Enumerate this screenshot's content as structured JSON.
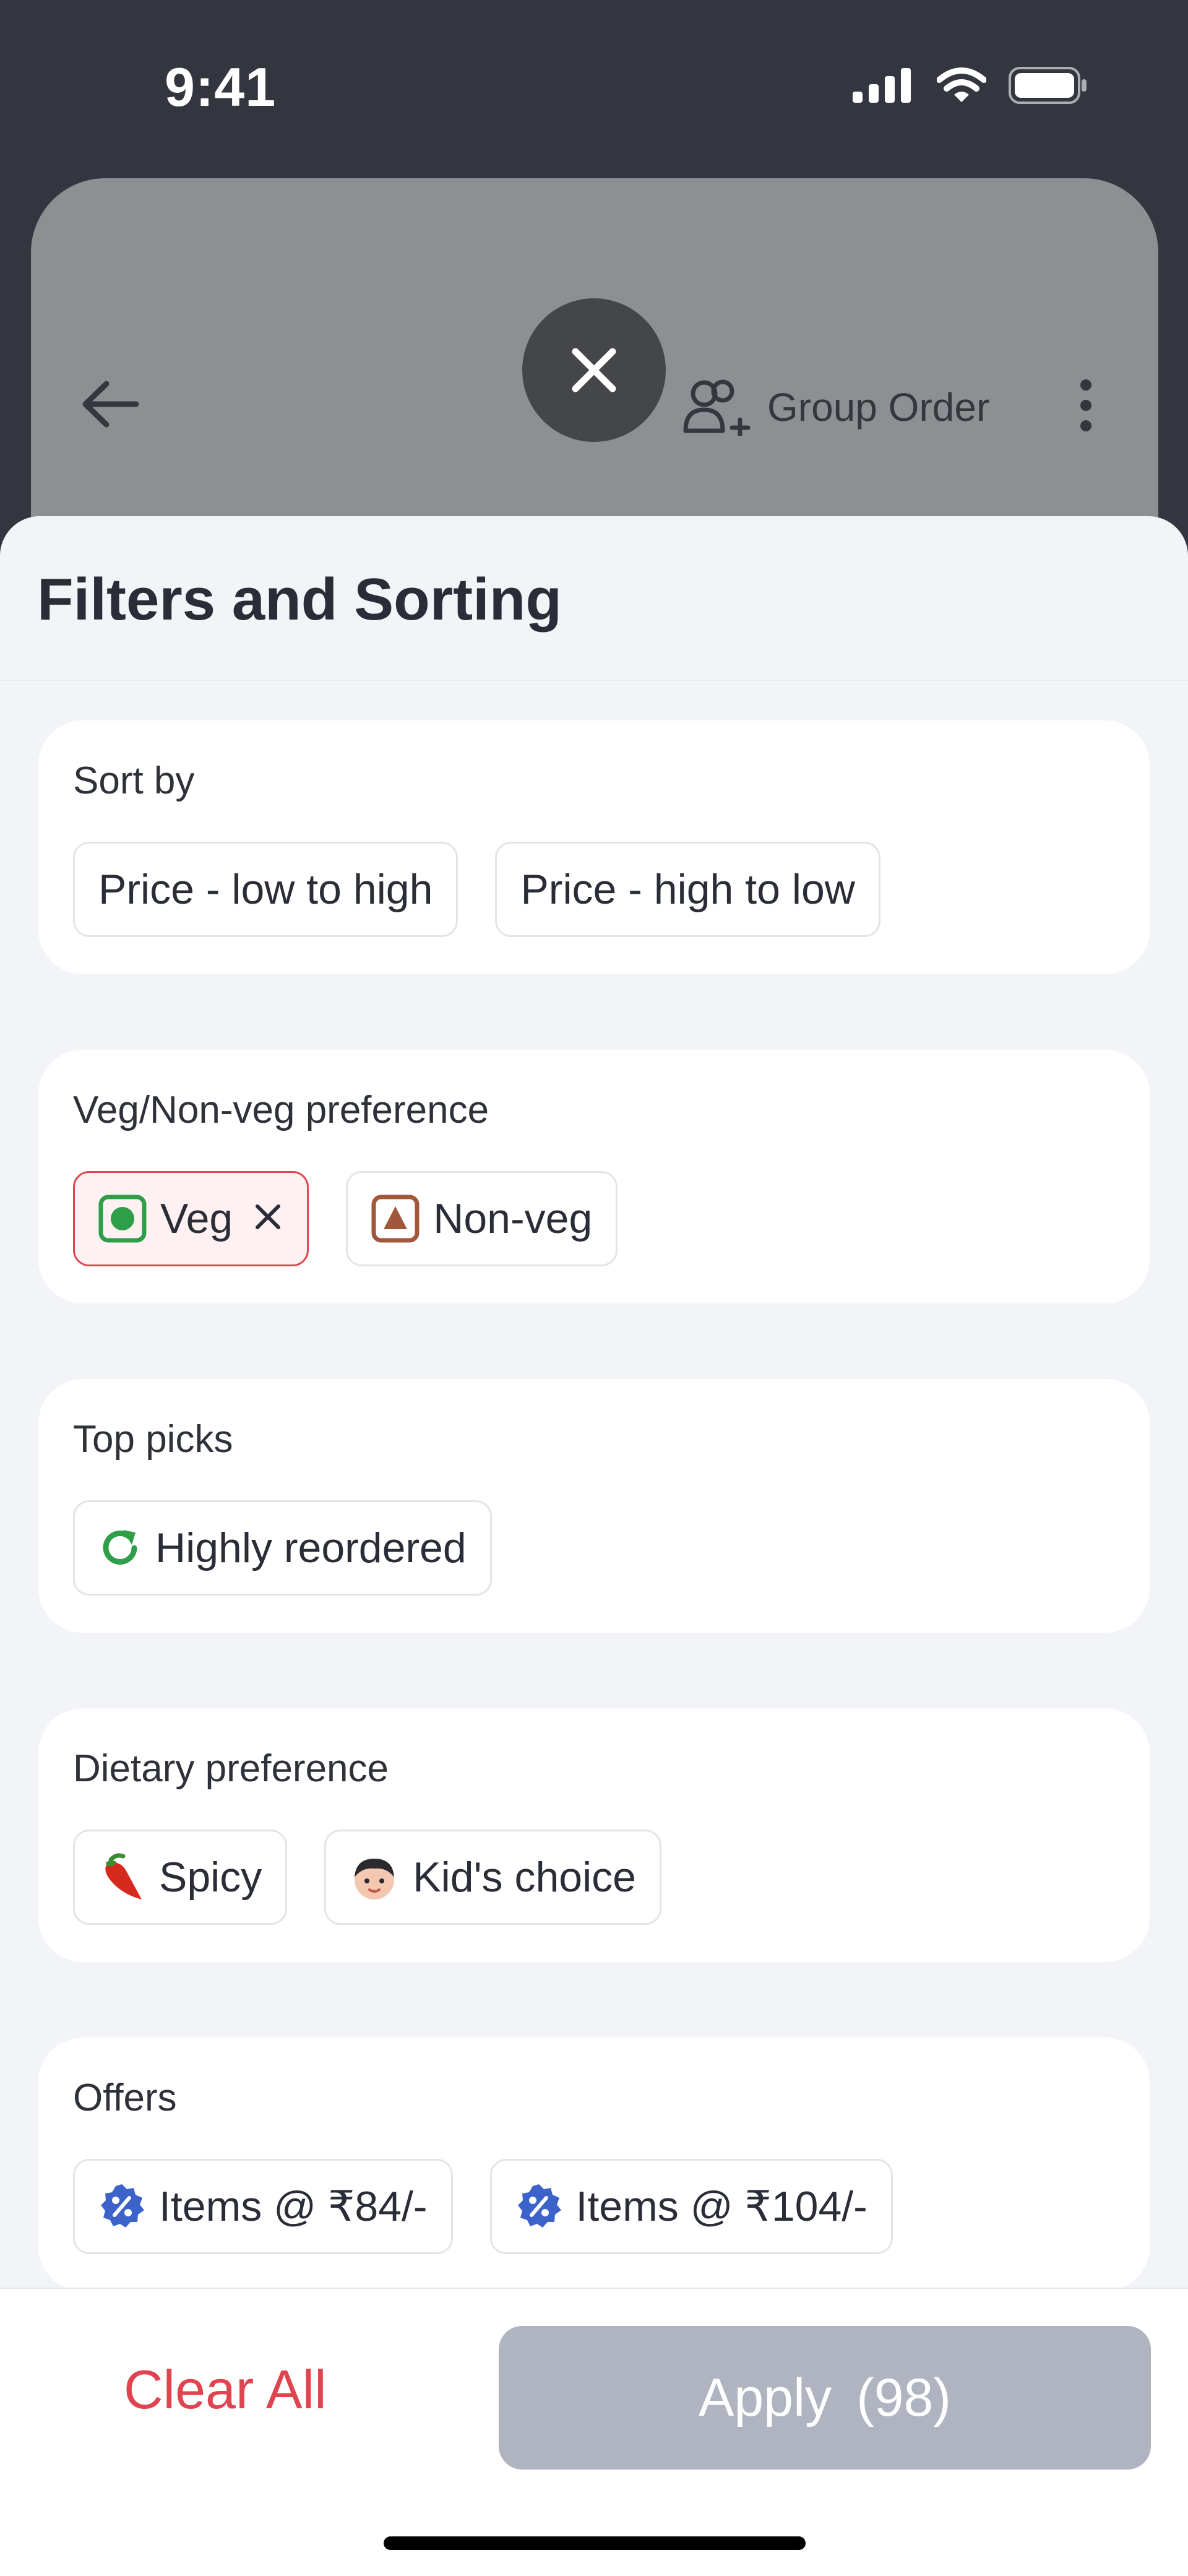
{
  "status": {
    "time": "9:41"
  },
  "background": {
    "group_order_label": "Group Order"
  },
  "sheet": {
    "title": "Filters and Sorting",
    "sections": [
      {
        "title": "Sort by",
        "chips": [
          {
            "label": "Price - low to high"
          },
          {
            "label": "Price - high to low"
          }
        ]
      },
      {
        "title": "Veg/Non-veg preference",
        "chips": [
          {
            "label": "Veg",
            "selected": true
          },
          {
            "label": "Non-veg"
          }
        ]
      },
      {
        "title": "Top picks",
        "chips": [
          {
            "label": "Highly reordered"
          }
        ]
      },
      {
        "title": "Dietary preference",
        "chips": [
          {
            "label": "Spicy"
          },
          {
            "label": "Kid's choice"
          }
        ]
      },
      {
        "title": "Offers",
        "chips": [
          {
            "label": "Items @ ₹84/-"
          },
          {
            "label": "Items @ ₹104/-"
          }
        ]
      }
    ]
  },
  "footer": {
    "clear_all": "Clear All",
    "apply_label": "Apply",
    "apply_count": "(98)"
  },
  "icons": {
    "veg": "veg-icon",
    "nonveg": "nonveg-icon",
    "reorder": "reorder-icon",
    "spicy": "chili-icon",
    "kids": "kid-face-icon",
    "offer": "discount-badge-icon"
  },
  "colors": {
    "accent": "#e0444f",
    "veg": "#2e9e49",
    "nonveg": "#a0573a",
    "apply_disabled": "#b0b4c0"
  }
}
